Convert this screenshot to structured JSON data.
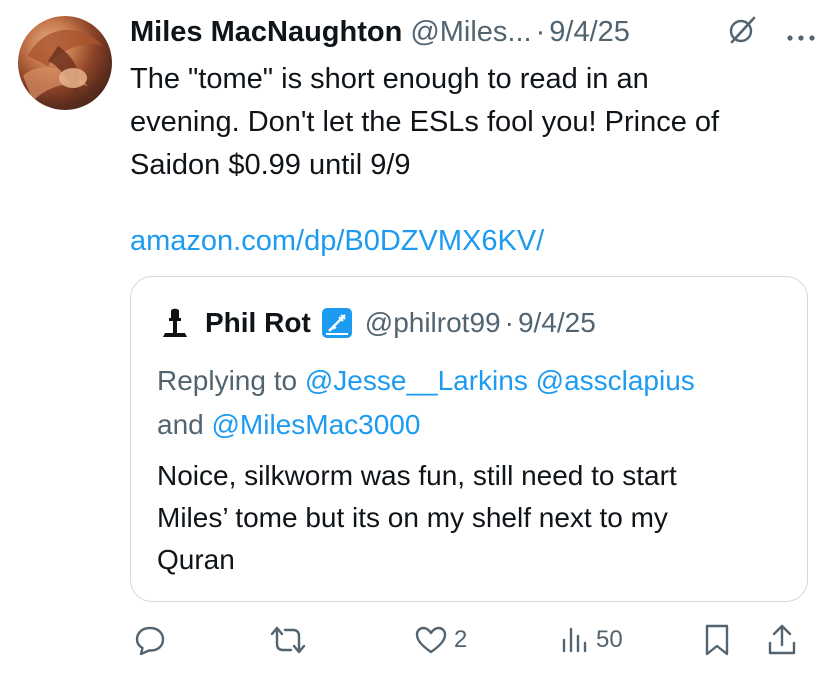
{
  "tweet": {
    "author_name": "Miles MacNaughton",
    "handle": "@Miles...",
    "separator": "·",
    "date": "9/4/25",
    "text_lines": [
      "The \"tome\" is short enough to read in an",
      "evening. Don't let the ESLs fool you! Prince of",
      "Saidon $0.99 until 9/9"
    ],
    "link": "amazon.com/dp/B0DZVMX6KV/"
  },
  "quote": {
    "author_name": "Phil Rot",
    "handle": "@philrot99",
    "separator": "·",
    "date": "9/4/25",
    "replying_prefix": "Replying to ",
    "mention_1": "@Jesse__Larkins",
    "mention_2": "@assclapius",
    "and_text": "and ",
    "mention_3": "@MilesMac3000",
    "text_lines": [
      "Noice, silkworm was fun, still need to start",
      "Miles’ tome but its on my shelf next to my",
      "Quran"
    ]
  },
  "actions": {
    "likes": "2",
    "views": "50"
  },
  "icons": {
    "avatar": "profile-photo",
    "grok": "grok-icon",
    "more": "more-icon",
    "reply": "reply-icon",
    "retweet": "retweet-icon",
    "like": "heart-icon",
    "views": "views-icon",
    "bookmark": "bookmark-icon",
    "share": "share-icon"
  },
  "colors": {
    "accent": "#1d9bf0",
    "secondary_text": "#536471",
    "border": "#cfd9de"
  }
}
